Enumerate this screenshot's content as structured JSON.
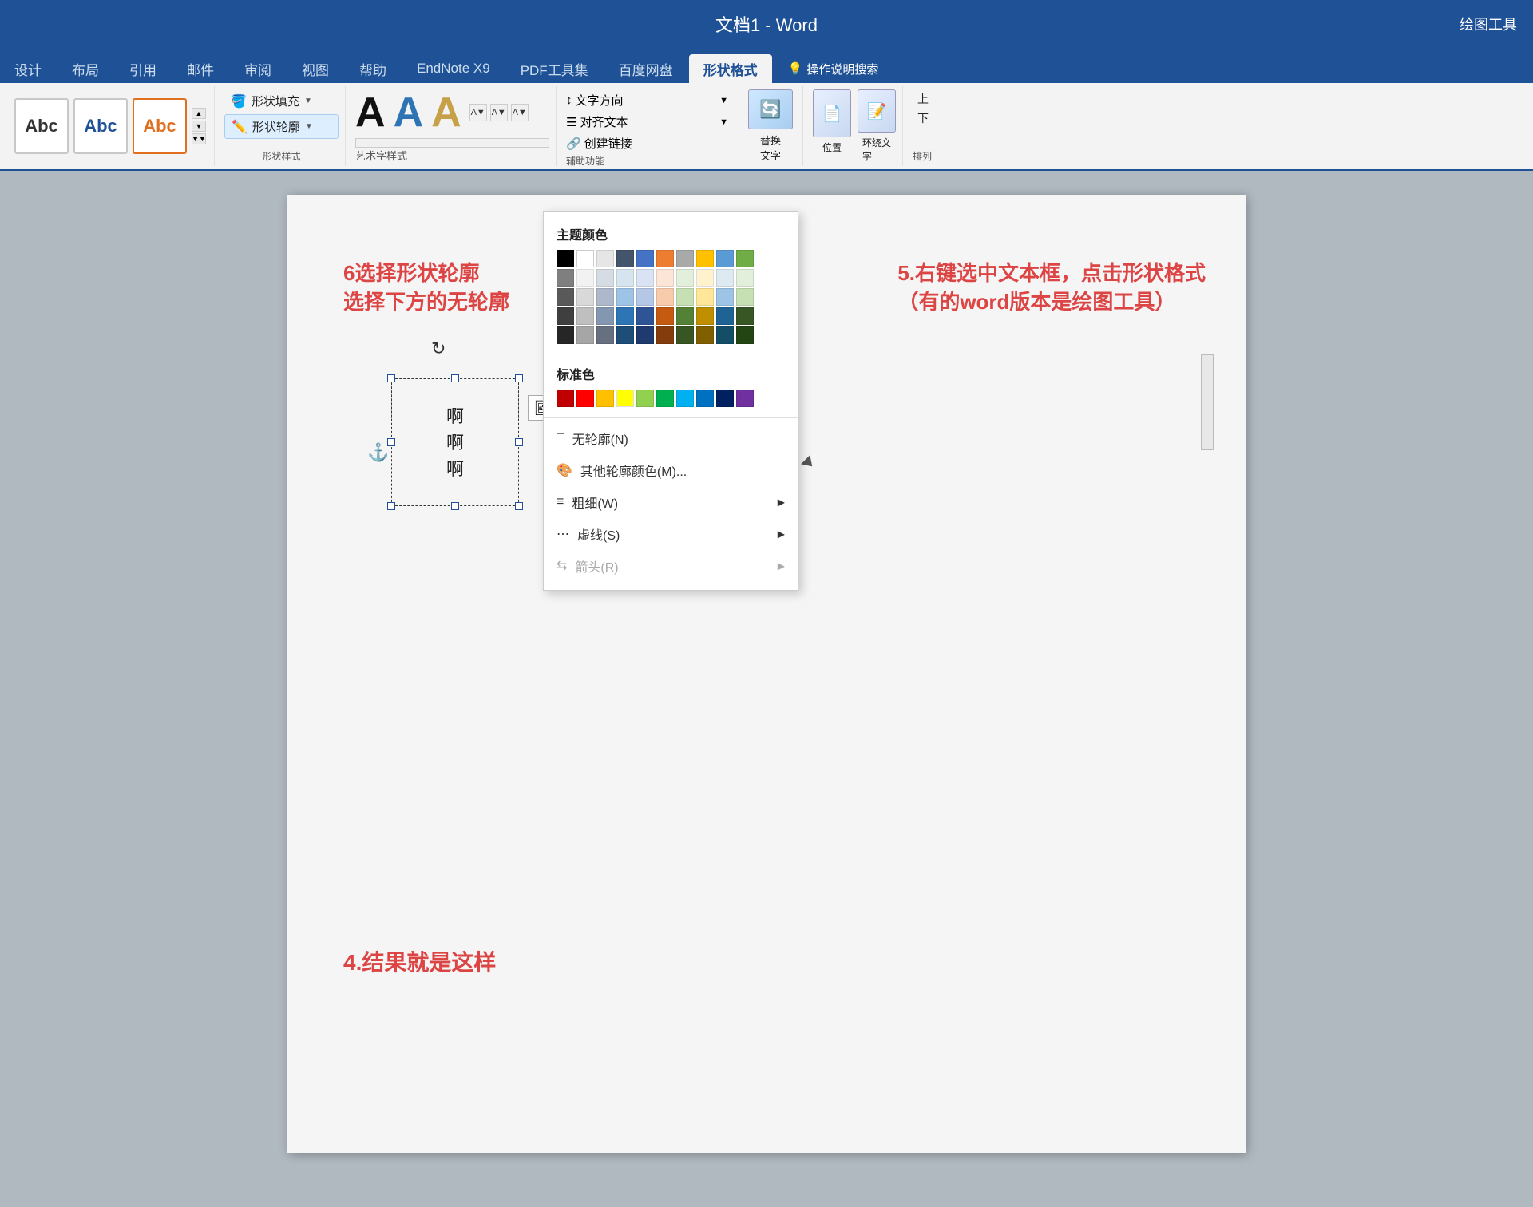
{
  "titlebar": {
    "text": "文档1 - Word",
    "right_label": "绘图工具"
  },
  "tabs": [
    {
      "label": "设计",
      "active": false
    },
    {
      "label": "布局",
      "active": false
    },
    {
      "label": "引用",
      "active": false
    },
    {
      "label": "邮件",
      "active": false
    },
    {
      "label": "审阅",
      "active": false
    },
    {
      "label": "视图",
      "active": false
    },
    {
      "label": "帮助",
      "active": false
    },
    {
      "label": "EndNote X9",
      "active": false
    },
    {
      "label": "PDF工具集",
      "active": false
    },
    {
      "label": "百度网盘",
      "active": false
    },
    {
      "label": "形状格式",
      "active": true
    },
    {
      "label": "操作说明搜索",
      "active": false
    }
  ],
  "ribbon": {
    "shape_styles_label": "形状样式",
    "shape_fill_label": "形状填充",
    "shape_outline_label": "形状轮廓",
    "artword_styles_label": "艺术字样式",
    "text_direction_label": "文字方向",
    "align_text_label": "对齐文本",
    "create_link_label": "创建链接",
    "auxiliary_label": "辅助功能",
    "replace_text_label": "替换\n文字",
    "position_label": "位置",
    "wrap_label": "环绕文\n字",
    "arrange_label": "排列"
  },
  "dropdown": {
    "theme_colors_title": "主题颜色",
    "standard_colors_title": "标准色",
    "no_outline_label": "无轮廓(N)",
    "other_colors_label": "其他轮廓颜色(M)...",
    "weight_label": "粗细(W)",
    "dashes_label": "虚线(S)",
    "arrows_label": "箭头(R)",
    "theme_colors": [
      [
        "#000000",
        "#ffffff",
        "#e7e6e6",
        "#44546a",
        "#4472c4",
        "#ed7d31",
        "#a9d18e",
        "#ffc000",
        "#5b9bd5",
        "#70ad47"
      ],
      [
        "#7f7f7f",
        "#f2f2f2",
        "#d6dce4",
        "#d6e4f0",
        "#dae3f3",
        "#fce4d6",
        "#e2efda",
        "#fff2cc",
        "#deeaf1",
        "#e2efda"
      ],
      [
        "#595959",
        "#d9d9d9",
        "#adb9ca",
        "#9dc3e6",
        "#b4c7e7",
        "#f8cbad",
        "#c6e0b4",
        "#ffe699",
        "#9dc3e6",
        "#c6e0b4"
      ],
      [
        "#3f3f3f",
        "#bfbfbf",
        "#8497b0",
        "#2e75b6",
        "#2f5496",
        "#c55a11",
        "#538135",
        "#bf8f00",
        "#1f6394",
        "#375623"
      ],
      [
        "#262626",
        "#a6a6a6",
        "#677080",
        "#1e4d78",
        "#1e3a6e",
        "#843c0c",
        "#375623",
        "#7f5f00",
        "#134e66",
        "#234514"
      ]
    ],
    "standard_colors": [
      "#c00000",
      "#ff0000",
      "#ffc000",
      "#ffff00",
      "#92d050",
      "#00b050",
      "#00b0f0",
      "#0070c0",
      "#002060",
      "#7030a0"
    ]
  },
  "textbox": {
    "text": "啊\n啊\n啊"
  },
  "annotations": {
    "step6": "6选择形状轮廓\n选择下方的无轮廓",
    "step5": "5.右键选中文本框，点击形状格式\n（有的word版本是绘图工具）",
    "step4": "4.结果就是这样"
  }
}
